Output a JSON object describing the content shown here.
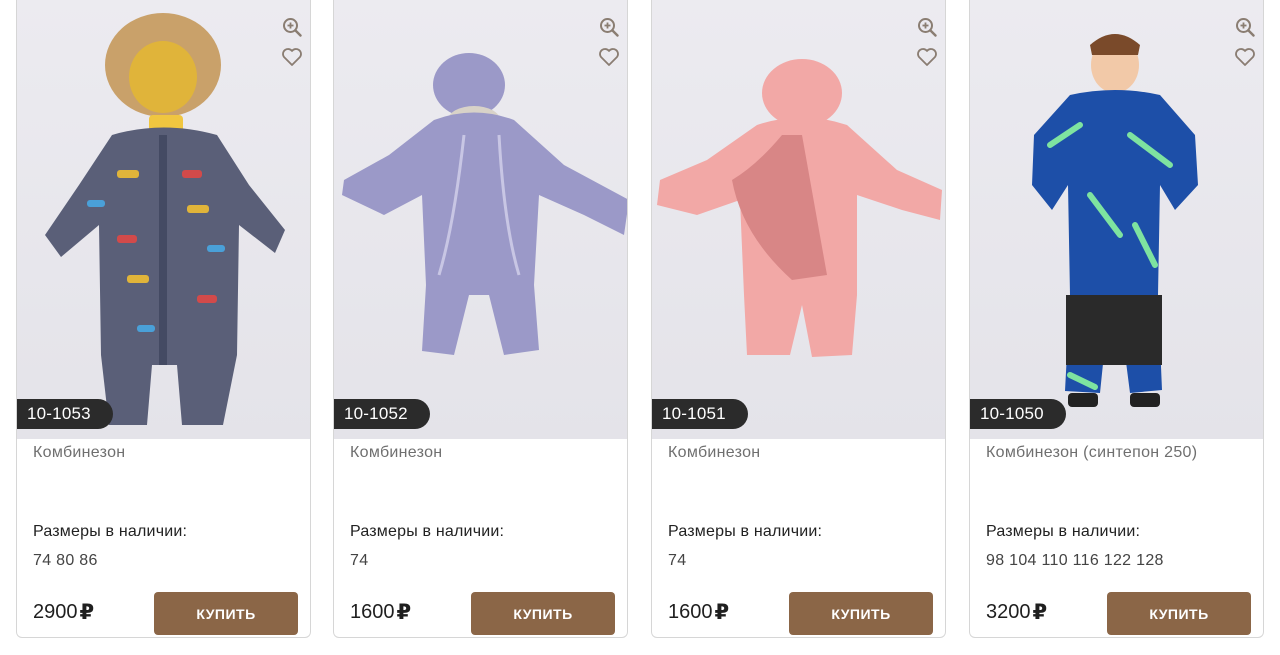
{
  "currency_symbol": "₽",
  "products": [
    {
      "sku": "10-1053",
      "name": "Комбинезон",
      "sizes_label": "Размеры в наличии:",
      "sizes": "74 80 86",
      "price": "2900",
      "buy_label": "КУПИТЬ",
      "image_colors": {
        "main": "#5a5f78",
        "accent": "#e0b43a",
        "fur": "#c9a16a"
      }
    },
    {
      "sku": "10-1052",
      "name": "Комбинезон",
      "sizes_label": "Размеры в наличии:",
      "sizes": "74",
      "price": "1600",
      "buy_label": "КУПИТЬ",
      "image_colors": {
        "main": "#9b99c8"
      }
    },
    {
      "sku": "10-1051",
      "name": "Комбинезон",
      "sizes_label": "Размеры в наличии:",
      "sizes": "74",
      "price": "1600",
      "buy_label": "КУПИТЬ",
      "image_colors": {
        "main": "#f2a8a6",
        "lining": "#d88686"
      }
    },
    {
      "sku": "10-1050",
      "name": "Комбинезон (синтепон 250)",
      "sizes_label": "Размеры в наличии:",
      "sizes": "98 104 110 116 122 128",
      "price": "3200",
      "buy_label": "КУПИТЬ",
      "image_colors": {
        "main": "#1d4fa8",
        "accent": "#7ee3a0",
        "legs": "#2a2a2a"
      }
    }
  ],
  "icons": {
    "zoom": "zoom-in-icon",
    "favorite": "heart-outline-icon"
  },
  "colors": {
    "button": "#8b6647",
    "sku_badge": "#2b2b2b"
  }
}
